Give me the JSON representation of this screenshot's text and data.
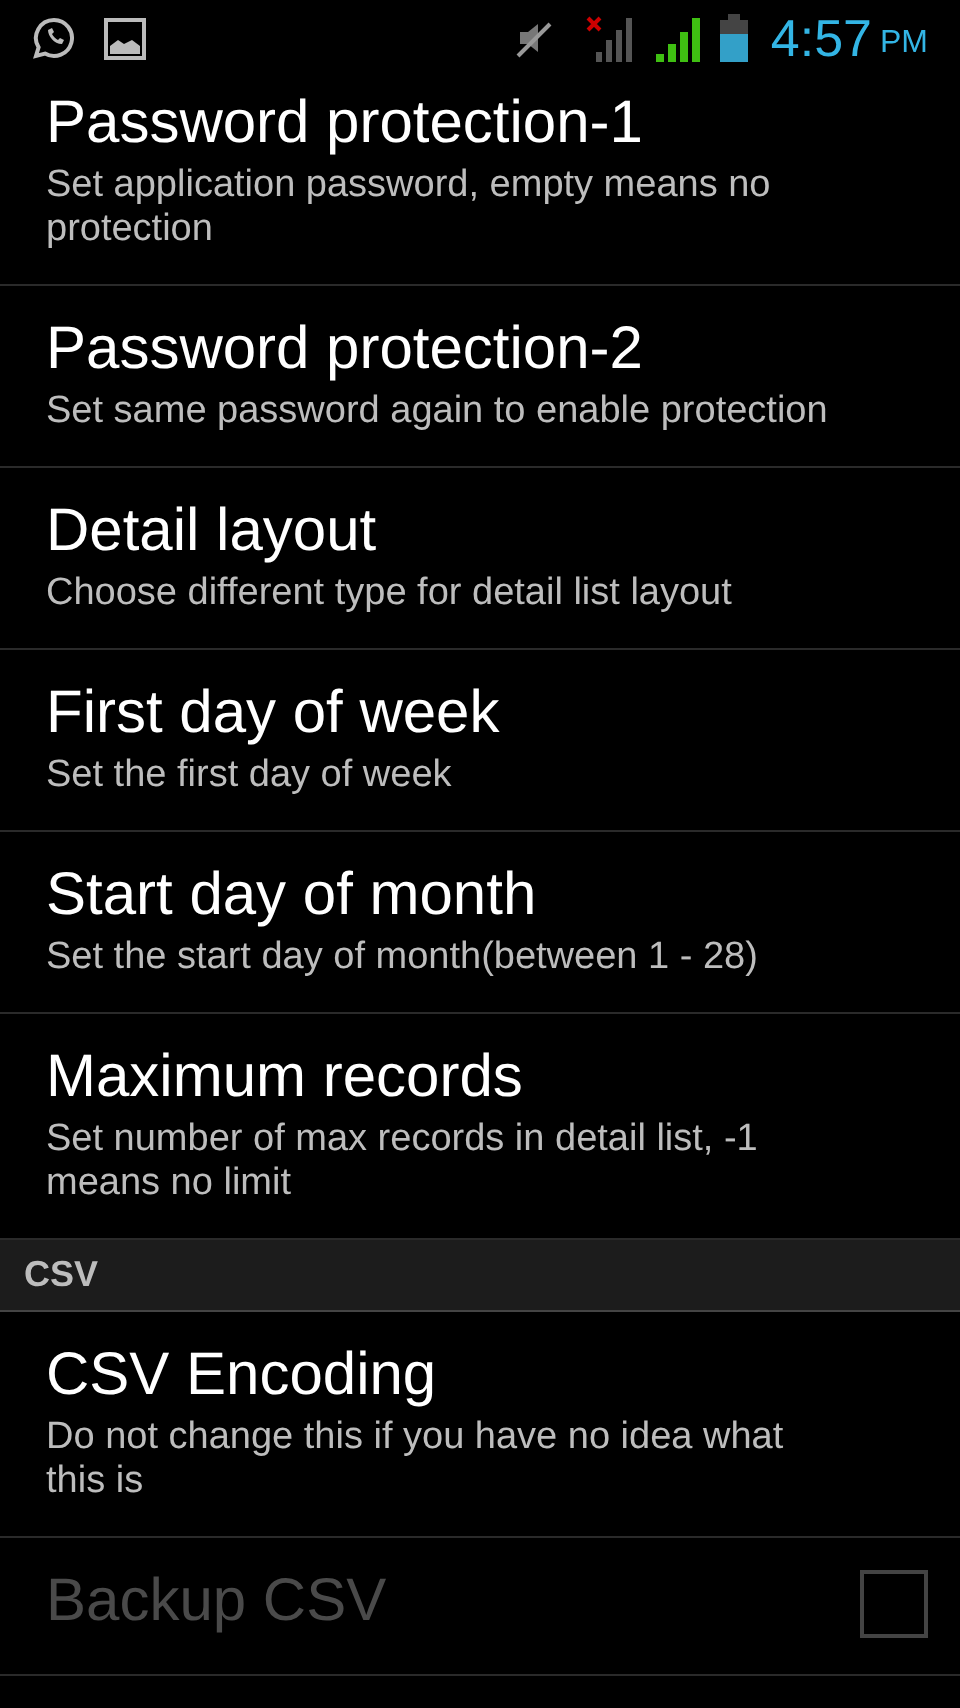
{
  "status_bar": {
    "time": "4:57",
    "am_pm": "PM"
  },
  "items": [
    {
      "kind": "preference",
      "title": "Password protection-1",
      "summary": "Set application password, empty means no protection",
      "disabled": false
    },
    {
      "kind": "preference",
      "title": "Password protection-2",
      "summary": "Set same password again to enable protection",
      "disabled": false
    },
    {
      "kind": "preference",
      "title": "Detail layout",
      "summary": "Choose different type for detail list layout",
      "disabled": false
    },
    {
      "kind": "preference",
      "title": "First day of week",
      "summary": "Set the first day of week",
      "disabled": false
    },
    {
      "kind": "preference",
      "title": "Start day of month",
      "summary": "Set the start day of month(between 1 - 28)",
      "disabled": false
    },
    {
      "kind": "preference",
      "title": "Maximum records",
      "summary": "Set number of max records in detail list, -1 means no limit",
      "disabled": false
    },
    {
      "kind": "header",
      "title": "CSV"
    },
    {
      "kind": "preference",
      "title": "CSV Encoding",
      "summary": "Do not change this if you have no idea what this is",
      "disabled": false
    },
    {
      "kind": "checkbox",
      "title": "Backup CSV",
      "disabled": true,
      "checked": false
    }
  ]
}
